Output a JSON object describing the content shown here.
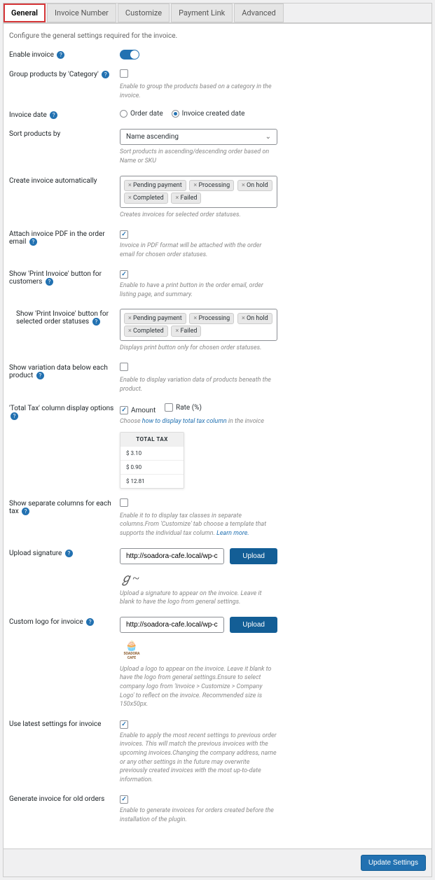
{
  "tabs": [
    "General",
    "Invoice Number",
    "Customize",
    "Payment Link",
    "Advanced"
  ],
  "intro": "Configure the general settings required for the invoice.",
  "fields": {
    "enable_invoice": "Enable invoice",
    "group_category": {
      "label": "Group products by 'Category'",
      "hint": "Enable to group the products based on a category in the invoice."
    },
    "invoice_date": {
      "label": "Invoice date",
      "opts": [
        "Order date",
        "Invoice created date"
      ]
    },
    "sort_products": {
      "label": "Sort products by",
      "value": "Name ascending",
      "hint": "Sort products in ascending/descending order based on Name or SKU"
    },
    "auto_invoice": {
      "label": "Create invoice automatically",
      "chips": [
        "Pending payment",
        "Processing",
        "On hold",
        "Completed",
        "Failed"
      ],
      "hint": "Creates invoices for selected order statuses."
    },
    "attach_pdf": {
      "label": "Attach invoice PDF in the order email",
      "hint": "Invoice in PDF format will be attached with the order email for chosen order statuses."
    },
    "print_button": {
      "label": "Show 'Print Invoice' button for customers",
      "hint": "Enable to have a print button in the order email, order listing page, and summary."
    },
    "print_statuses": {
      "label": "Show 'Print Invoice' button for selected order statuses",
      "chips": [
        "Pending payment",
        "Processing",
        "On hold",
        "Completed",
        "Failed"
      ],
      "hint": "Displays print button only for chosen order statuses."
    },
    "variation_data": {
      "label": "Show variation data below each product",
      "hint": "Enable to display variation data of products beneath the product."
    },
    "total_tax": {
      "label": "'Total Tax' column display options",
      "opts": [
        "Amount",
        "Rate (%)"
      ],
      "hint_pre": "Choose ",
      "hint_link": "how to display total tax column",
      "hint_post": " in the invoice"
    },
    "tax_table": {
      "header": "TOTAL TAX",
      "rows": [
        "$ 3.10",
        "$ 0.90",
        "$ 12.81"
      ]
    },
    "separate_tax": {
      "label": "Show separate columns for each tax",
      "hint_pre": "Enable it to to display tax classes in separate columns.From 'Customize' tab choose a template that supports the individual tax column. ",
      "hint_link": "Learn more."
    },
    "upload_sig": {
      "label": "Upload signature",
      "value": "http://soadora-cafe.local/wp-content/up",
      "btn": "Upload",
      "hint": "Upload a signature to appear on the invoice. Leave it blank to have the logo from general settings."
    },
    "custom_logo": {
      "label": "Custom logo for invoice",
      "value": "http://soadora-cafe.local/wp-content/up",
      "btn": "Upload",
      "logo_text": "SOADORA CAFE",
      "hint": "Upload a logo to appear on the invoice. Leave it blank to have the logo from general settings.Ensure to select company logo from 'Invoice > Customize > Company Logo' to reflect on the invoice. Recommended size is 150x50px."
    },
    "latest_settings": {
      "label": "Use latest settings for invoice",
      "hint": "Enable to apply the most recent settings to previous order invoices. This will match the previous invoices with the upcoming invoices.Changing the company address, name or any other settings in the future may overwrite previously created invoices with the most up-to-date information."
    },
    "old_orders": {
      "label": "Generate invoice for old orders",
      "hint": "Enable to generate invoices for orders created before the installation of the plugin."
    }
  },
  "footer_btn": "Update Settings"
}
